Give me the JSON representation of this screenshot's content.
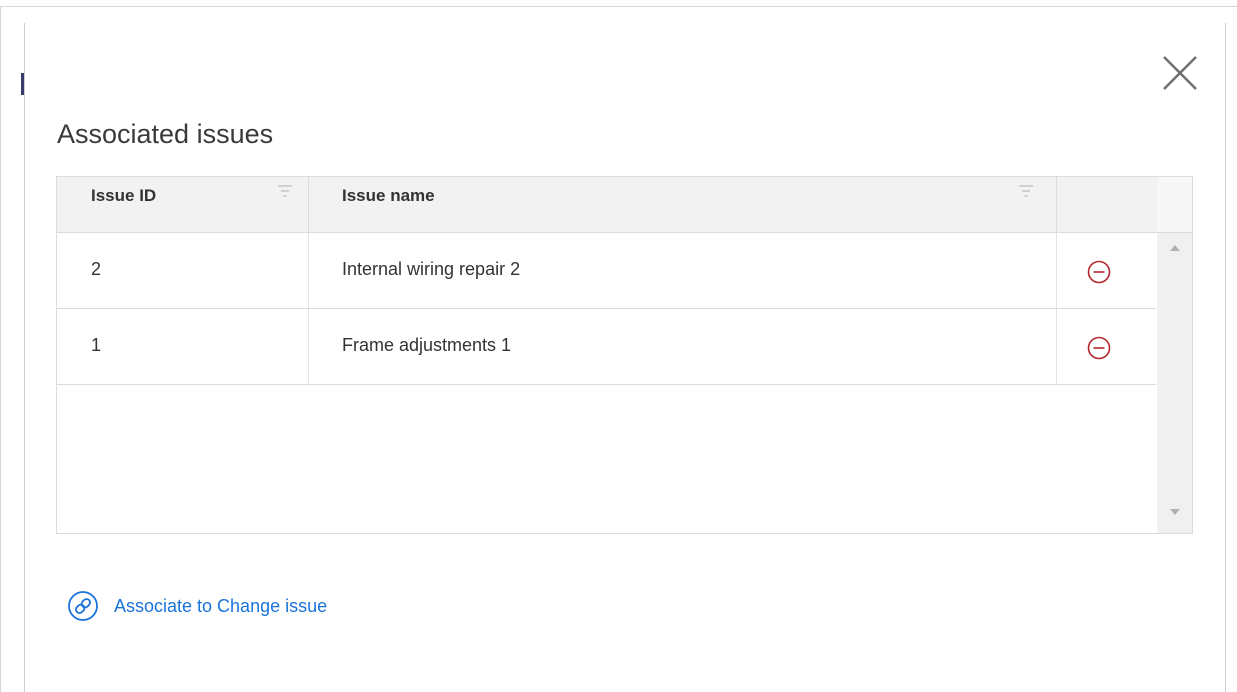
{
  "dialog": {
    "title": "Associated issues",
    "close_icon": "close-icon"
  },
  "table": {
    "columns": [
      {
        "label": "Issue ID",
        "icon": "filter-icon"
      },
      {
        "label": "Issue name",
        "icon": "filter-icon"
      }
    ],
    "rows": [
      {
        "id": "2",
        "name": "Internal wiring repair 2",
        "action_icon": "remove-circle-icon"
      },
      {
        "id": "1",
        "name": "Frame adjustments 1",
        "action_icon": "remove-circle-icon"
      }
    ]
  },
  "footer": {
    "link_label": "Associate to Change issue",
    "link_icon": "link-icon"
  },
  "colors": {
    "accent": "#1a73d9",
    "remove": "#b5262c",
    "header_bg": "#f2f2f2",
    "border": "#dcdcdc"
  }
}
